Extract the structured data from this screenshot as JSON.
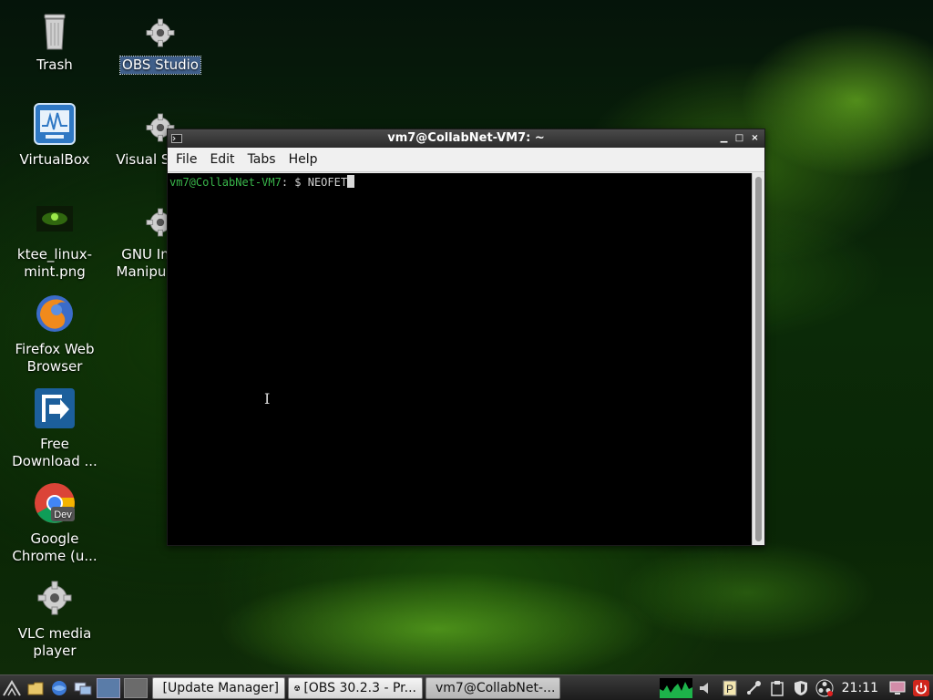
{
  "desktop": {
    "icons": [
      {
        "label": "Trash",
        "icon": "trash-icon"
      },
      {
        "label": "OBS Studio",
        "icon": "gear-icon",
        "selected": true
      },
      {
        "label": "VirtualBox",
        "icon": "virtualbox-icon"
      },
      {
        "label": "Visual Studio",
        "icon": "gear-icon"
      },
      {
        "label": "ktee_linux-mint.png",
        "icon": "image-file-icon"
      },
      {
        "label": "GNU Image Manipulation",
        "icon": "gear-icon"
      },
      {
        "label": "Firefox Web Browser",
        "icon": "firefox-icon"
      },
      {
        "label": "Free Download ...",
        "icon": "free-download-manager-icon"
      },
      {
        "label": "Google Chrome (u...",
        "icon": "chrome-dev-icon",
        "badge": "Dev"
      },
      {
        "label": "VLC media player",
        "icon": "gear-icon"
      }
    ]
  },
  "terminal": {
    "title": "vm7@CollabNet-VM7: ~",
    "menu": [
      "File",
      "Edit",
      "Tabs",
      "Help"
    ],
    "prompt_user_host": "vm7@CollabNet-VM7",
    "prompt_sep": ": $ ",
    "command": "NEOFET",
    "controls": {
      "minimize": "▁",
      "maximize": "□",
      "close": "×"
    }
  },
  "taskbar": {
    "tasks": [
      {
        "label": "[Update Manager]",
        "icon": "shield-icon"
      },
      {
        "label": "[OBS 30.2.3 - Pr...",
        "icon": "obs-icon"
      },
      {
        "label": "vm7@CollabNet-...",
        "icon": "terminal-icon"
      }
    ],
    "clock": "21:11"
  },
  "colors": {
    "prompt_green": "#39b54a",
    "selection_blue": "#3f5f8a"
  }
}
